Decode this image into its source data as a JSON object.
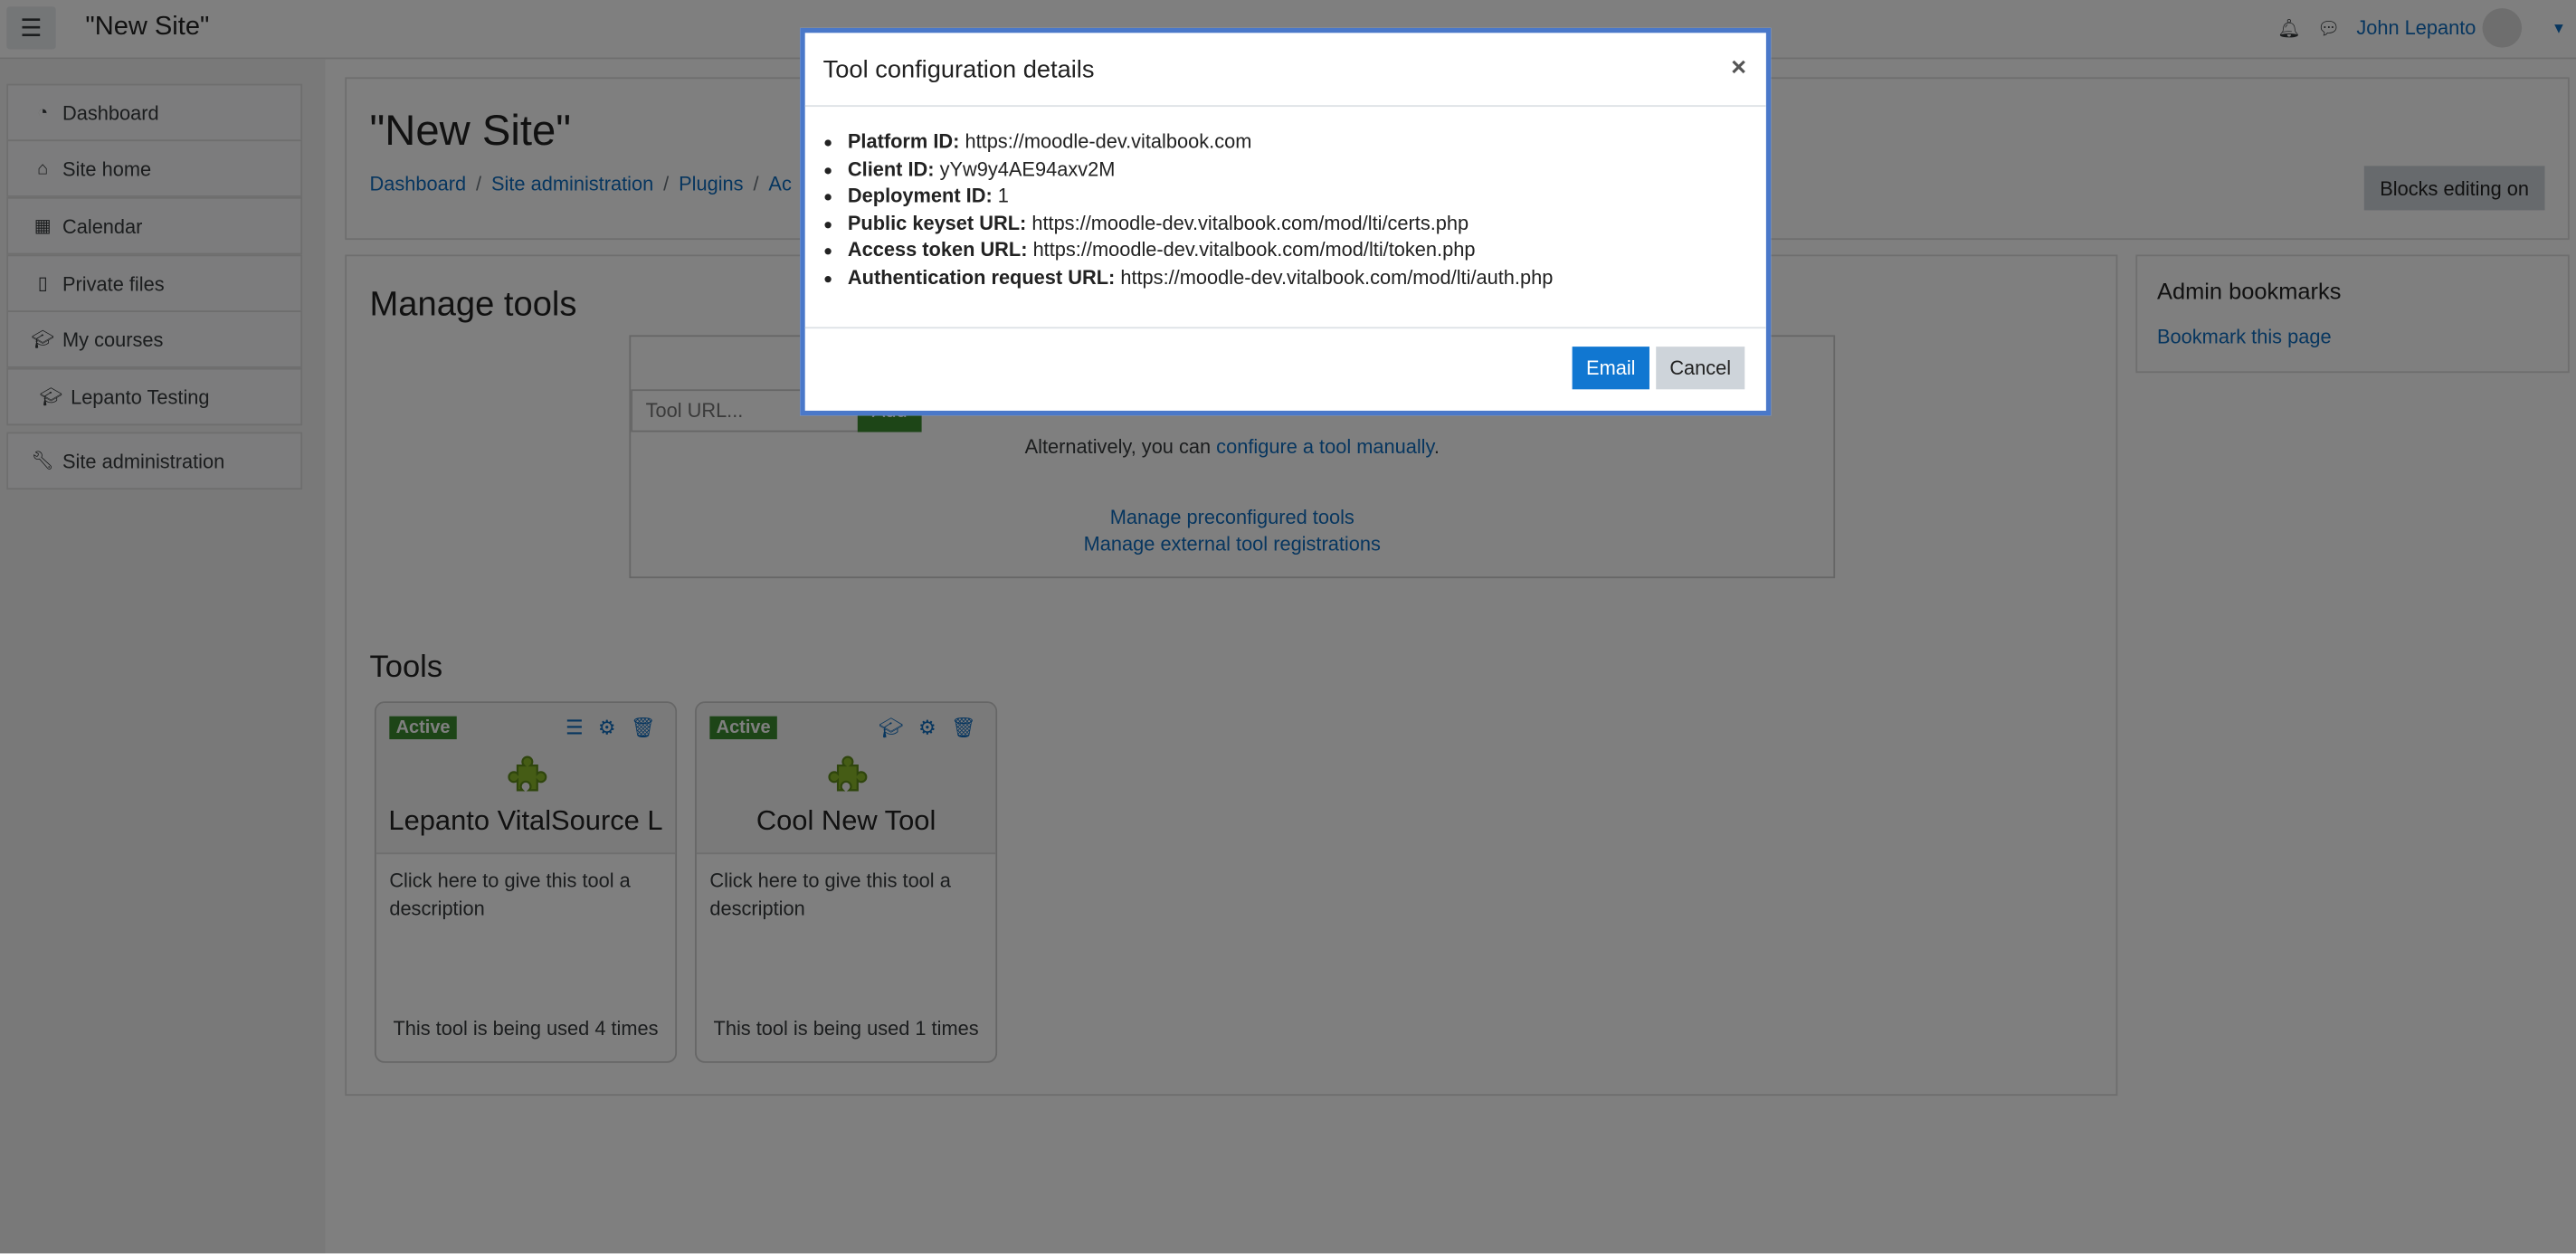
{
  "navbar": {
    "site_name": "\"New Site\"",
    "user_name": "John Lepanto",
    "icons": [
      "menu-icon",
      "bell-icon",
      "chat-icon",
      "avatar",
      "caret-down-icon"
    ]
  },
  "sidebar": {
    "items": [
      {
        "label": "Dashboard",
        "icon": "dashboard-icon"
      },
      {
        "label": "Site home",
        "icon": "home-icon"
      },
      {
        "label": "Calendar",
        "icon": "calendar-icon"
      },
      {
        "label": "Private files",
        "icon": "file-icon"
      },
      {
        "label": "My courses",
        "icon": "graduation-cap-icon"
      },
      {
        "label": "Lepanto Testing",
        "icon": "graduation-cap-icon"
      },
      {
        "label": "Site administration",
        "icon": "wrench-icon"
      }
    ]
  },
  "header": {
    "title": "\"New Site\"",
    "breadcrumb": [
      "Dashboard",
      "Site administration",
      "Plugins",
      "Ac"
    ],
    "blocks_button": "Blocks editing on"
  },
  "manage": {
    "title": "Manage tools",
    "url_placeholder": "Tool URL...",
    "add_label": "Add",
    "alt_text": "Alternatively, you can ",
    "alt_link": "configure a tool manually",
    "alt_end": ".",
    "link1": "Manage preconfigured tools",
    "link2": "Manage external tool registrations"
  },
  "tools": {
    "title": "Tools",
    "cards": [
      {
        "status": "Active",
        "name": "Lepanto VitalSource L",
        "description": "Click here to give this tool a description",
        "usage": "This tool is being used 4 times",
        "icons": [
          "list-icon",
          "gear-icon",
          "trash-icon"
        ]
      },
      {
        "status": "Active",
        "name": "Cool New Tool",
        "description": "Click here to give this tool a description",
        "usage": "This tool is being used 1 times",
        "icons": [
          "graduation-cap-icon",
          "gear-icon",
          "trash-icon"
        ]
      }
    ]
  },
  "bookmarks": {
    "title": "Admin bookmarks",
    "link": "Bookmark this page"
  },
  "modal": {
    "title": "Tool configuration details",
    "close": "×",
    "items": [
      {
        "label": "Platform ID:",
        "value": "https://moodle-dev.vitalbook.com"
      },
      {
        "label": "Client ID:",
        "value": "yYw9y4AE94axv2M"
      },
      {
        "label": "Deployment ID:",
        "value": "1"
      },
      {
        "label": "Public keyset URL:",
        "value": "https://moodle-dev.vitalbook.com/mod/lti/certs.php"
      },
      {
        "label": "Access token URL:",
        "value": "https://moodle-dev.vitalbook.com/mod/lti/token.php"
      },
      {
        "label": "Authentication request URL:",
        "value": "https://moodle-dev.vitalbook.com/mod/lti/auth.php"
      }
    ],
    "email_label": "Email",
    "cancel_label": "Cancel"
  },
  "colors": {
    "accent": "#0f6cbf",
    "primary_button": "#1177d1",
    "active_badge": "#3a8a2e",
    "modal_border": "#4a78c9"
  }
}
